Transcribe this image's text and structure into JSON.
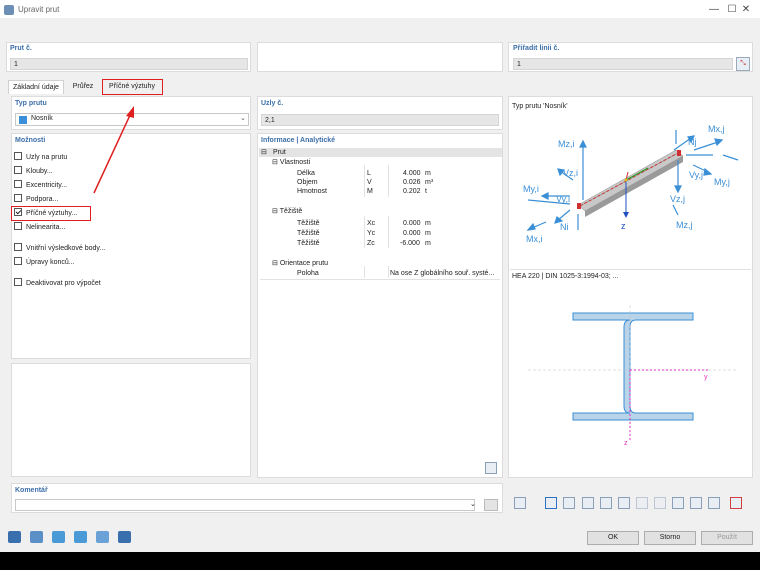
{
  "window": {
    "title": "Upravit prut",
    "minimize": "—",
    "maximize": "☐",
    "close": "✕"
  },
  "top": {
    "member_no_label": "Prut č.",
    "member_no_value": "1",
    "assign_lines_label": "Přiřadit linii č.",
    "assign_lines_value": "1"
  },
  "tabs": [
    "Základní údaje",
    "Průřez",
    "Příčné výztuhy"
  ],
  "member_type": {
    "label": "Typ prutu",
    "value": "Nosník"
  },
  "nodes": {
    "label": "Uzly č.",
    "value": "2,1"
  },
  "options": {
    "label": "Možnosti",
    "items": [
      {
        "label": "Uzly na prutu",
        "checked": false
      },
      {
        "label": "Klouby...",
        "checked": false
      },
      {
        "label": "Excentricity...",
        "checked": false
      },
      {
        "label": "Podpora...",
        "checked": false
      },
      {
        "label": "Příčné výztuhy...",
        "checked": true
      },
      {
        "label": "Nelinearita...",
        "checked": false
      },
      {
        "label": "Vnitřní výsledkové body...",
        "checked": false
      },
      {
        "label": "Úpravy konců...",
        "checked": false
      },
      {
        "label": "Deaktivovat pro výpočet",
        "checked": false
      }
    ]
  },
  "info": {
    "header": "Informace | Analytické",
    "root": "Prut",
    "group1": "Vlastnosti",
    "rows1": [
      {
        "name": "Délka",
        "sym": "L",
        "val": "4.000",
        "unit": "m"
      },
      {
        "name": "Objem",
        "sym": "V",
        "val": "0.026",
        "unit": "m³"
      },
      {
        "name": "Hmotnost",
        "sym": "M",
        "val": "0.202",
        "unit": "t"
      }
    ],
    "group2": "Těžiště",
    "rows2": [
      {
        "name": "Těžiště",
        "sym": "Xc",
        "val": "0.000",
        "unit": "m"
      },
      {
        "name": "Těžiště",
        "sym": "Yc",
        "val": "0.000",
        "unit": "m"
      },
      {
        "name": "Těžiště",
        "sym": "Zc",
        "val": "-6.000",
        "unit": "m"
      }
    ],
    "group3": "Orientace prutu",
    "rows3": [
      {
        "name": "Poloha",
        "val": "Na ose Z globálního souř. systé..."
      }
    ]
  },
  "preview": {
    "type_caption": "Typ prutu 'Nosník'",
    "section_caption": "HEA 220 | DIN 1025-3:1994-03; ...",
    "labels": {
      "mxj": "Mx,j",
      "mzj": "Mz,j",
      "nj": "Nj",
      "vzj": "Vz,j",
      "vyj": "Vy,j",
      "myj": "My,j",
      "vyi": "Vy,i",
      "vzi": "Vz,i",
      "myi": "My,i",
      "ni": "Ni",
      "mxi": "Mx,i",
      "mzi": "Mz,i",
      "z": "z",
      "y": "y",
      "zsec": "z"
    }
  },
  "comment": {
    "label": "Komentář",
    "value": ""
  },
  "buttons": {
    "ok": "OK",
    "cancel": "Storno",
    "apply": "Použít"
  },
  "colors": {
    "accent_blue": "#3c6ea8",
    "highlight_red": "#e02020",
    "section_fill": "#b9d4e8"
  }
}
